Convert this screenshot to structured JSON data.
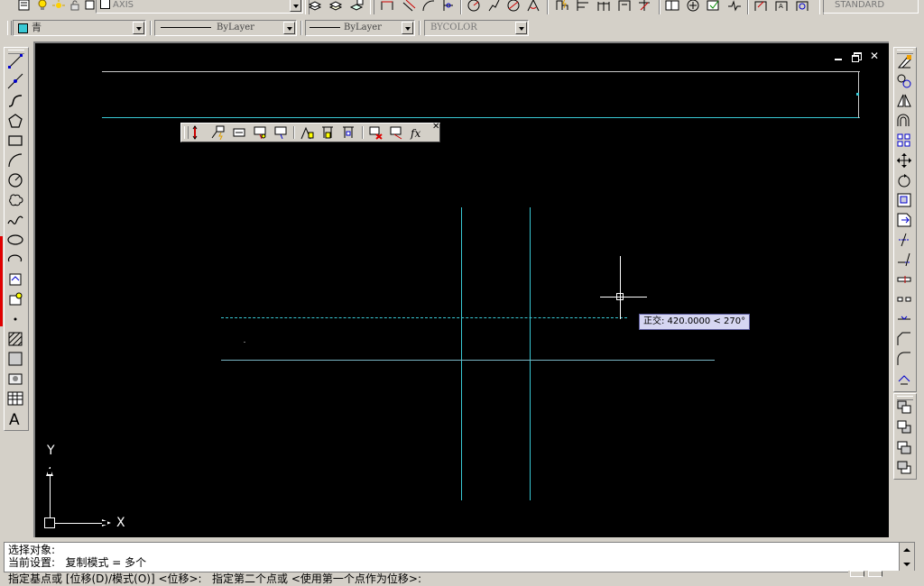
{
  "layer_toolbar": {
    "current_layer": "AXIS"
  },
  "style_toolbar": {
    "text_style": "STANDARD"
  },
  "properties_toolbar": {
    "color": "青",
    "linetype": "ByLayer",
    "lineweight": "ByLayer",
    "plotstyle": "BYCOLOR"
  },
  "drawing_window": {
    "ucs_x": "X",
    "ucs_y": "Y",
    "tooltip": "正交: 420.0000 < 270°"
  },
  "command_line": {
    "lines": [
      "选择对象:",
      "当前设置:   复制模式 = 多个",
      "指定基点或 [位移(D)/模式(O)] <位移>:   指定第二个点或 <使用第一个点作为位移>:"
    ]
  },
  "colors": {
    "accent_cyan": "#39c8d4",
    "canvas_bg": "#000000",
    "chrome": "#d4d0c8",
    "tooltip_bg": "#d6d6f2"
  },
  "icons": {
    "draw_toolbar": [
      "line-icon",
      "construction-line-icon",
      "polyline-icon",
      "polygon-icon",
      "rectangle-icon",
      "arc-icon",
      "circle-icon",
      "revision-cloud-icon",
      "spline-icon",
      "ellipse-icon",
      "ellipse-arc-icon",
      "insert-block-icon",
      "make-block-icon",
      "point-icon",
      "hatch-icon",
      "gradient-icon",
      "region-icon",
      "table-icon",
      "multiline-text-icon"
    ],
    "modify_toolbar": [
      "erase-icon",
      "copy-icon",
      "mirror-icon",
      "offset-icon",
      "array-icon",
      "move-icon",
      "rotate-icon",
      "scale-icon",
      "stretch-icon",
      "trim-icon",
      "extend-icon",
      "break-at-point-icon",
      "break-icon",
      "join-icon",
      "chamfer-icon",
      "fillet-icon",
      "explode-icon"
    ],
    "draworder_toolbar": [
      "bring-to-front-icon",
      "send-to-back-icon",
      "bring-above-icon",
      "send-under-icon"
    ]
  }
}
